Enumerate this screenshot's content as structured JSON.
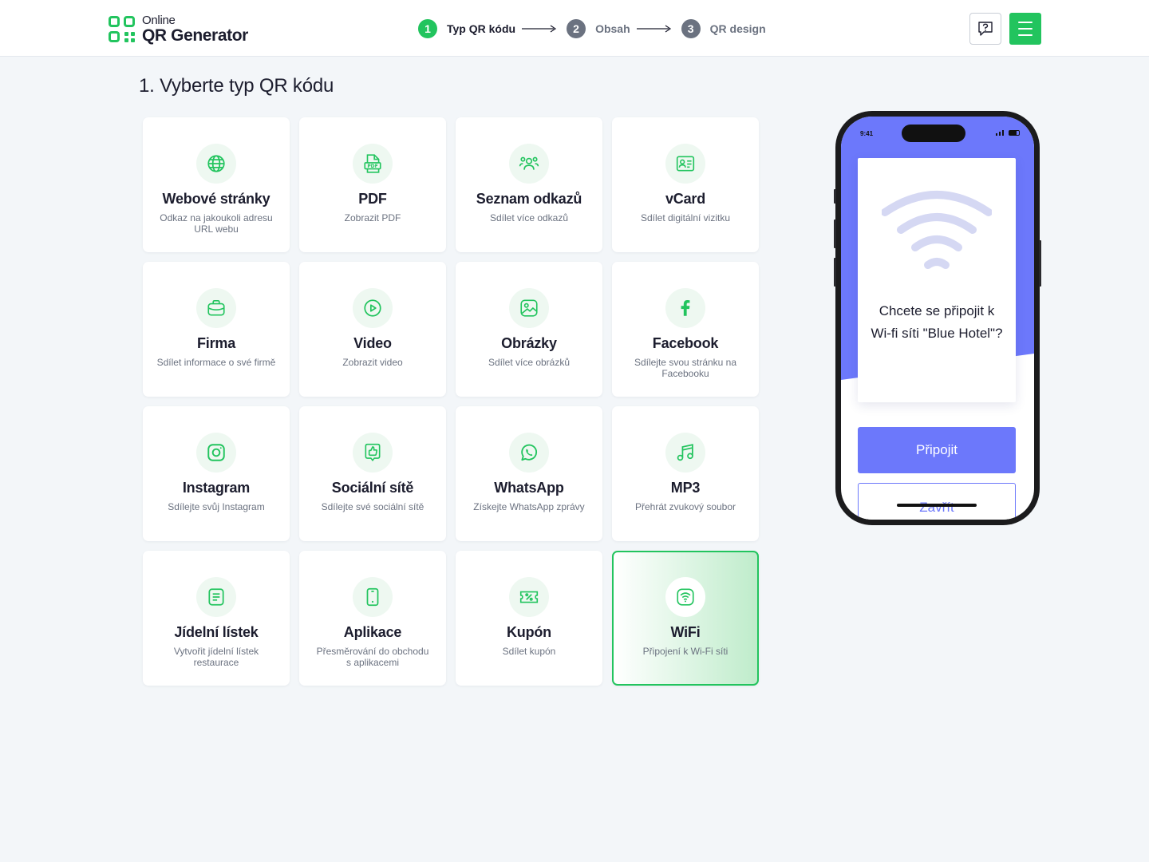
{
  "header": {
    "logo_online": "Online",
    "logo_name": "QR Generator",
    "steps": [
      {
        "num": "1",
        "label": "Typ QR kódu",
        "color": "#22c45e",
        "text_color": "#1c1d2e"
      },
      {
        "num": "2",
        "label": "Obsah",
        "color": "#6b7280",
        "text_color": "#6b7280"
      },
      {
        "num": "3",
        "label": "QR design",
        "color": "#6b7280",
        "text_color": "#6b7280"
      }
    ],
    "help_icon": "help-chat-icon",
    "menu_icon": "hamburger-menu-icon"
  },
  "page_title": "1. Vyberte typ QR kódu",
  "cards": [
    {
      "title": "Webové stránky",
      "desc": "Odkaz na jakoukoli adresu URL webu",
      "icon": "globe-icon"
    },
    {
      "title": "PDF",
      "desc": "Zobrazit PDF",
      "icon": "pdf-icon"
    },
    {
      "title": "Seznam odkazů",
      "desc": "Sdílet více odkazů",
      "icon": "links-list-icon"
    },
    {
      "title": "vCard",
      "desc": "Sdílet digitální vizitku",
      "icon": "vcard-icon"
    },
    {
      "title": "Firma",
      "desc": "Sdílet informace o své firmě",
      "icon": "briefcase-icon"
    },
    {
      "title": "Video",
      "desc": "Zobrazit video",
      "icon": "play-icon"
    },
    {
      "title": "Obrázky",
      "desc": "Sdílet více obrázků",
      "icon": "image-icon"
    },
    {
      "title": "Facebook",
      "desc": "Sdílejte svou stránku na Facebooku",
      "icon": "facebook-icon"
    },
    {
      "title": "Instagram",
      "desc": "Sdílejte svůj Instagram",
      "icon": "instagram-icon"
    },
    {
      "title": "Sociální sítě",
      "desc": "Sdílejte své sociální sítě",
      "icon": "thumbs-up-icon"
    },
    {
      "title": "WhatsApp",
      "desc": "Získejte WhatsApp zprávy",
      "icon": "whatsapp-icon"
    },
    {
      "title": "MP3",
      "desc": "Přehrát zvukový soubor",
      "icon": "music-icon"
    },
    {
      "title": "Jídelní lístek",
      "desc": "Vytvořit jídelní lístek restaurace",
      "icon": "menu-list-icon"
    },
    {
      "title": "Aplikace",
      "desc": "Přesměrování do obchodu s aplikacemi",
      "icon": "smartphone-icon"
    },
    {
      "title": "Kupón",
      "desc": "Sdílet kupón",
      "icon": "coupon-icon"
    },
    {
      "title": "WiFi",
      "desc": "Připojení k Wi-Fi síti",
      "icon": "wifi-icon",
      "selected": true
    }
  ],
  "phone_preview": {
    "time": "9:41",
    "question": "Chcete se připojit k Wi-fi síti \"Blue Hotel\"?",
    "connect_label": "Připojit",
    "close_label": "Zavřít",
    "accent": "#6c78fb"
  },
  "colors": {
    "brand": "#22c45e",
    "background": "#f3f6f9"
  }
}
